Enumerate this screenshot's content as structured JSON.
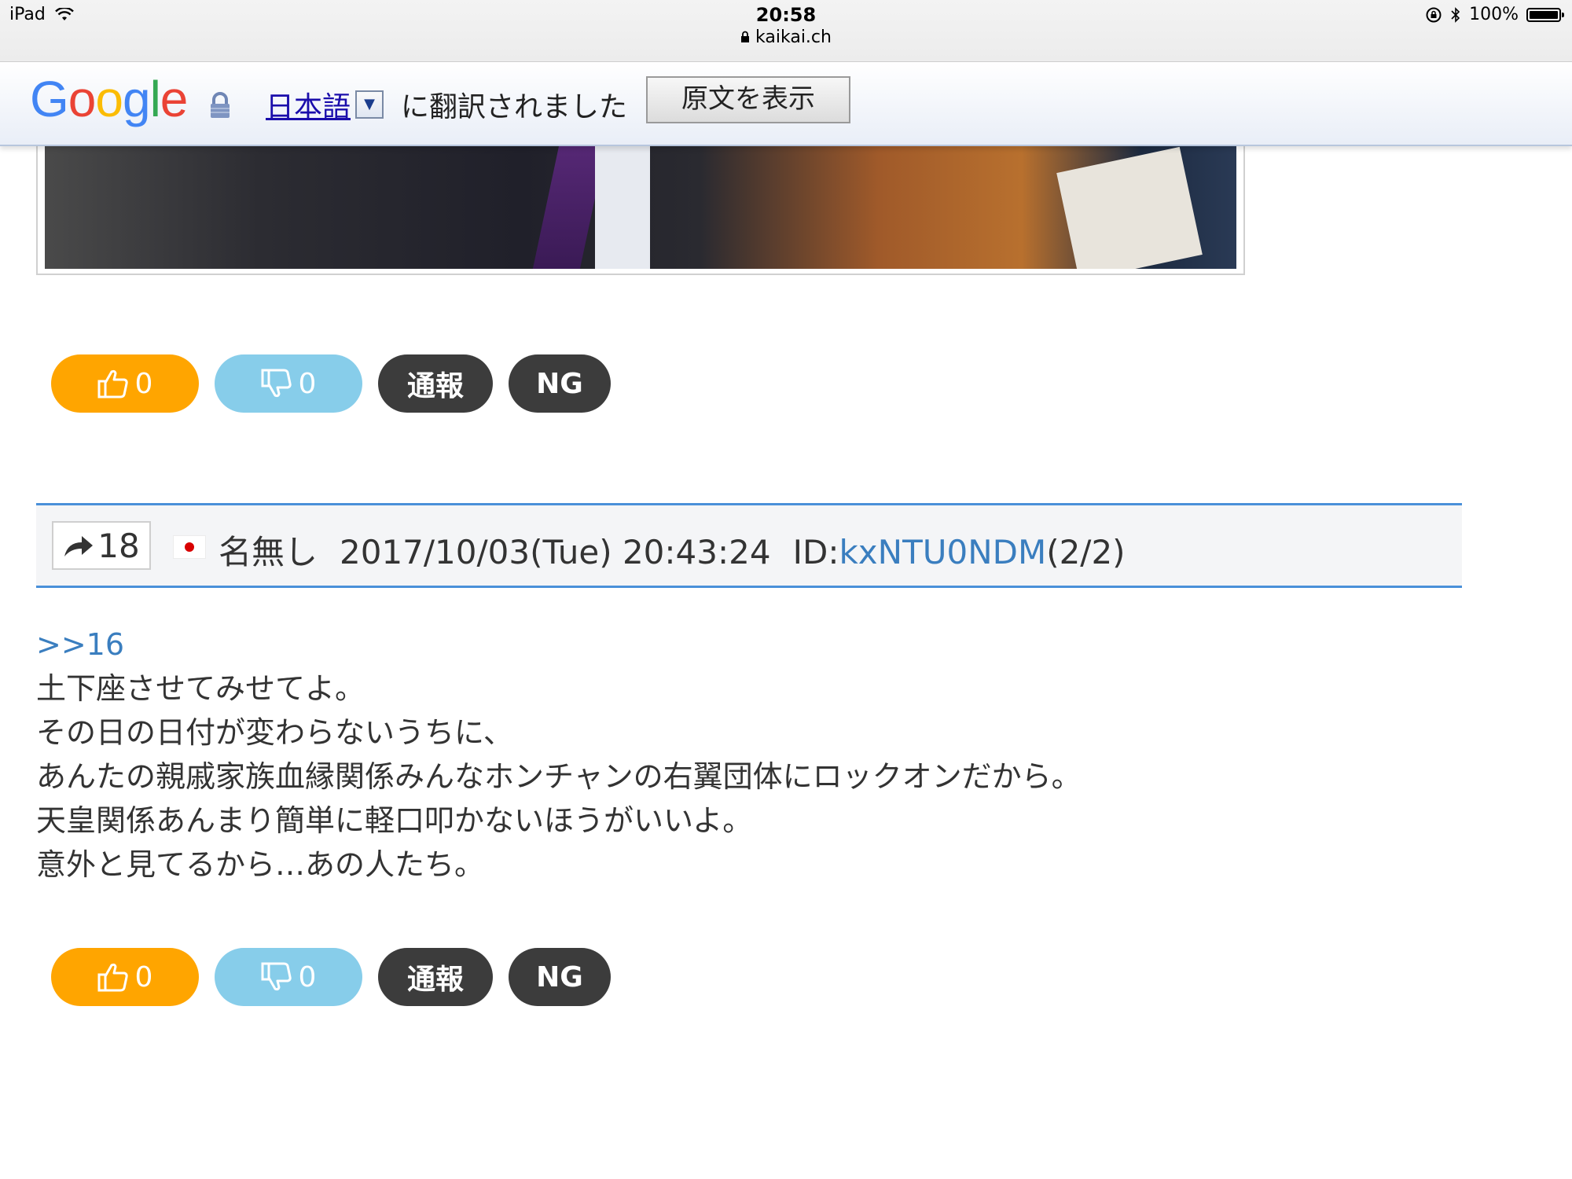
{
  "status_bar": {
    "device": "iPad",
    "time": "20:58",
    "url": "kaikai.ch",
    "battery": "100%"
  },
  "translate_bar": {
    "logo": "Google",
    "language": "日本語",
    "message": "に翻訳されました",
    "show_original": "原文を表示"
  },
  "post_top_actions": {
    "good_count": "0",
    "bad_count": "0",
    "report": "通報",
    "ng": "NG"
  },
  "post": {
    "number": "18",
    "name": "名無し",
    "date": "2017/10/03(Tue) 20:43:24",
    "id_label": "ID:",
    "id_value": "kxNTU0NDM",
    "id_count": "(2/2)",
    "anchor": ">>16",
    "lines": [
      "土下座させてみせてよ。",
      "その日の日付が変わらないうちに、",
      "あんたの親戚家族血縁関係みんなホンチャンの右翼団体にロックオンだから。",
      "天皇関係あんまり簡単に軽口叩かないほうがいいよ。",
      "意外と見てるから…あの人たち。"
    ],
    "actions": {
      "good_count": "0",
      "bad_count": "0",
      "report": "通報",
      "ng": "NG"
    }
  },
  "colors": {
    "good": "#ffa500",
    "bad": "#87cdea",
    "dark_button": "#3c3c3c",
    "link": "#3a7ebf",
    "header_border": "#4a90d9"
  },
  "icons": [
    "wifi-icon",
    "lock-icon",
    "orientation-lock-icon",
    "bluetooth-icon",
    "battery-icon",
    "thumbs-up-icon",
    "thumbs-down-icon",
    "reply-arrow-icon",
    "japan-flag-icon",
    "dropdown-arrow-icon"
  ]
}
